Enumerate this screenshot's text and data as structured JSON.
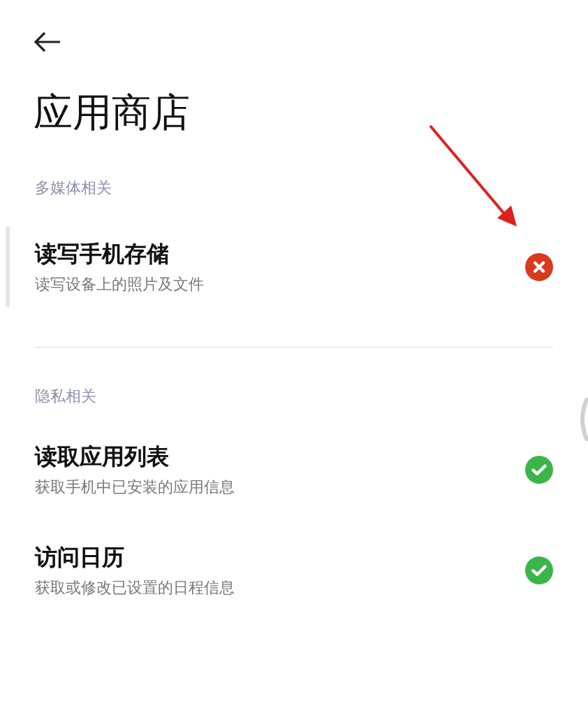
{
  "header": {
    "title": "应用商店"
  },
  "sections": [
    {
      "label": "多媒体相关",
      "items": [
        {
          "title": "读写手机存储",
          "description": "读写设备上的照片及文件",
          "granted": false,
          "highlighted": true
        }
      ]
    },
    {
      "label": "隐私相关",
      "items": [
        {
          "title": "读取应用列表",
          "description": "获取手机中已安装的应用信息",
          "granted": true,
          "highlighted": false
        },
        {
          "title": "访问日历",
          "description": "获取或修改已设置的日程信息",
          "granted": true,
          "highlighted": false
        }
      ]
    }
  ]
}
